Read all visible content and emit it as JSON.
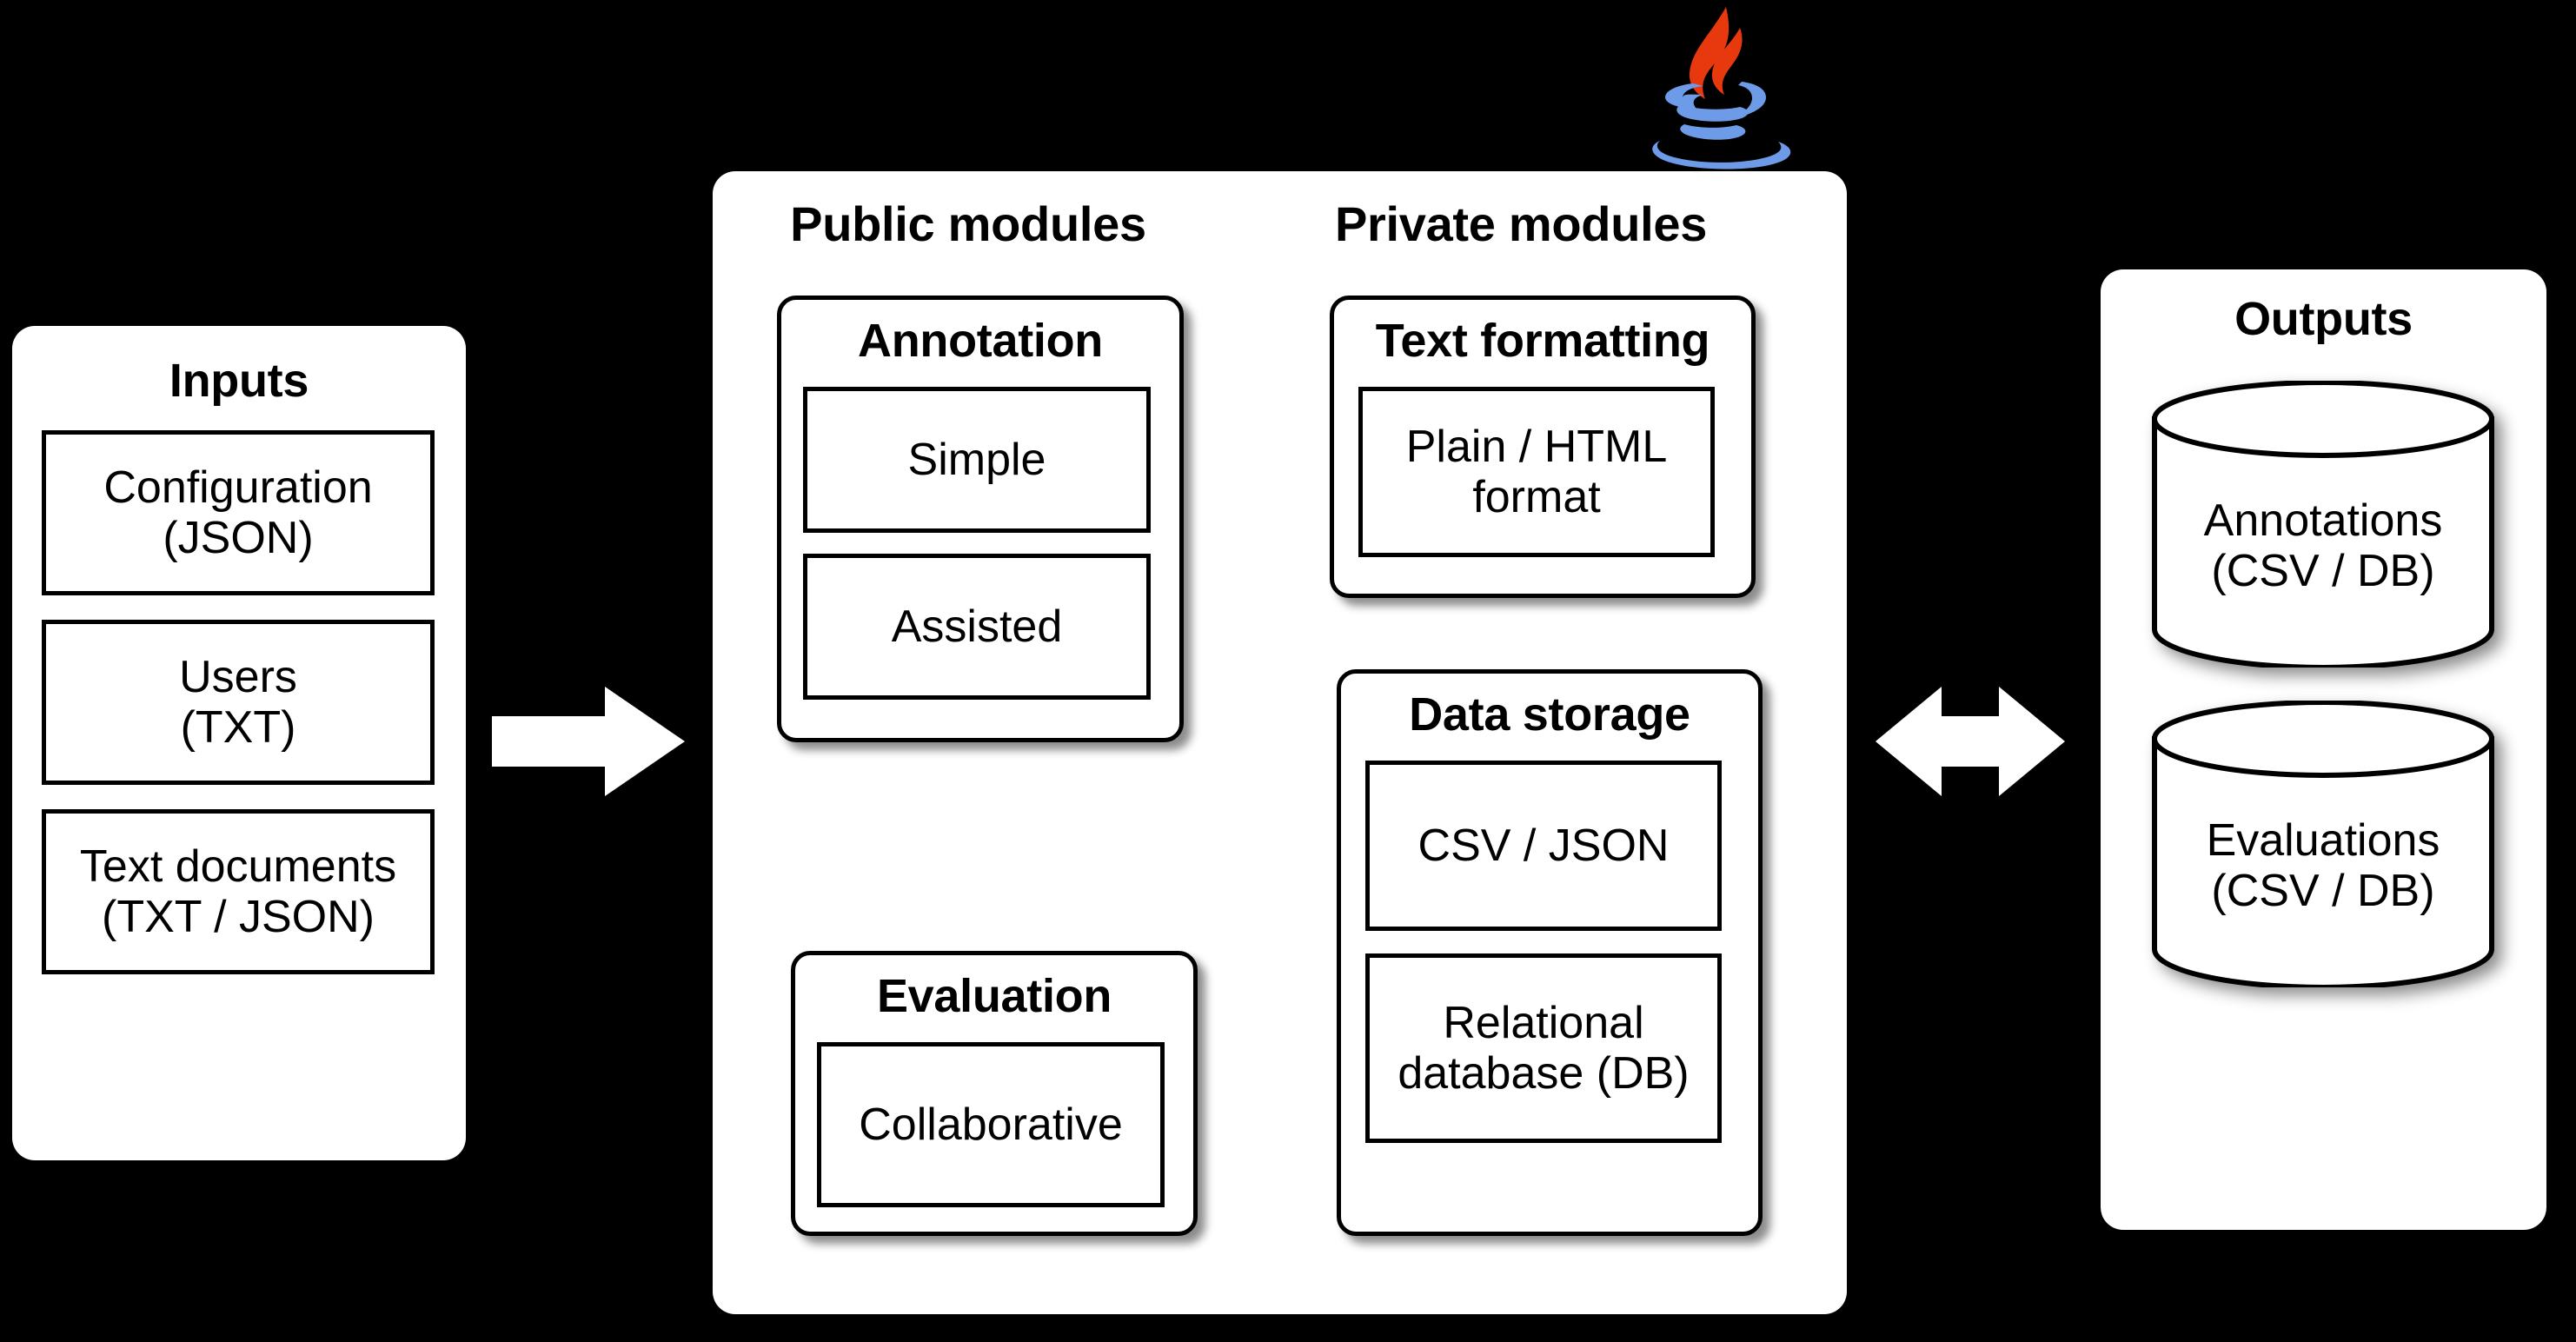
{
  "diagram": {
    "background_color": "#000000",
    "surface_color": "#ffffff",
    "stroke_color": "#000000"
  },
  "inputs_panel": {
    "title": "Inputs",
    "items": [
      {
        "label": "Configuration\n(JSON)"
      },
      {
        "label": "Users\n(TXT)"
      },
      {
        "label": "Text documents\n(TXT / JSON)"
      }
    ]
  },
  "main_panel": {
    "columns": [
      {
        "title": "Public modules"
      },
      {
        "title": "Private modules"
      }
    ],
    "public_groups": [
      {
        "title": "Annotation",
        "items": [
          {
            "label": "Simple"
          },
          {
            "label": "Assisted"
          }
        ]
      },
      {
        "title": "Evaluation",
        "items": [
          {
            "label": "Collaborative"
          }
        ]
      }
    ],
    "private_groups": [
      {
        "title": "Text formatting",
        "items": [
          {
            "label": "Plain / HTML\nformat"
          }
        ]
      },
      {
        "title": "Data storage",
        "items": [
          {
            "label": "CSV / JSON"
          },
          {
            "label": "Relational\ndatabase (DB)"
          }
        ]
      }
    ]
  },
  "outputs_panel": {
    "title": "Outputs",
    "stores": [
      {
        "label": "Annotations\n(CSV / DB)"
      },
      {
        "label": "Evaluations\n(CSV / DB)"
      }
    ]
  },
  "connectors": {
    "inputs_to_main": {
      "icon": "arrow-right-icon",
      "direction": "right"
    },
    "main_to_outputs": {
      "icon": "arrow-left-right-icon",
      "direction": "bidirectional"
    }
  },
  "technology_badge": {
    "icon": "java-logo-icon",
    "name": "Java",
    "steam_color": "#E76F00",
    "cup_color": "#6E9BE8"
  }
}
